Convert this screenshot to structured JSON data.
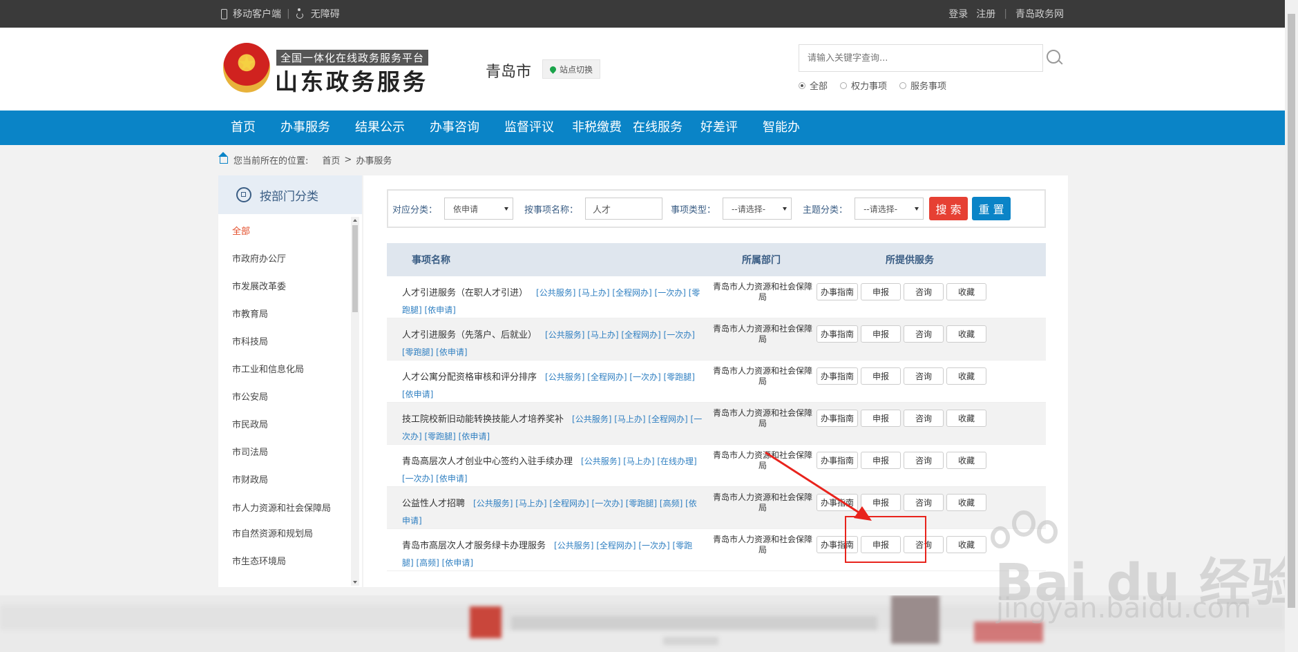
{
  "topbar": {
    "mobile_client": "移动客户端",
    "accessibility": "无障碍",
    "login": "登录",
    "register": "注册",
    "site_link": "青岛政务网"
  },
  "header": {
    "platform_subtitle": "全国一体化在线政务服务平台",
    "brand_title": "山东政务服务",
    "city": "青岛市",
    "switch_site": "站点切换",
    "search_placeholder": "请输入关键字查询...",
    "radio_options": [
      "全部",
      "权力事项",
      "服务事项"
    ],
    "radio_selected": "全部"
  },
  "nav": {
    "items": [
      "首页",
      "办事服务",
      "结果公示",
      "办事咨询",
      "监督评议",
      "非税缴费",
      "在线服务",
      "好差评",
      "智能办"
    ]
  },
  "breadcrumb": {
    "prefix": "您当前所在的位置:",
    "home": "首页",
    "separator": ">",
    "current": "办事服务"
  },
  "sidebar": {
    "title": "按部门分类",
    "items": [
      "全部",
      "市政府办公厅",
      "市发展改革委",
      "市教育局",
      "市科技局",
      "市工业和信息化局",
      "市公安局",
      "市民政局",
      "市司法局",
      "市财政局",
      "市人力资源和社会保障局",
      "市自然资源和规划局",
      "市生态环境局"
    ],
    "active": "全部"
  },
  "filter": {
    "category_label": "对应分类：",
    "category_value": "依申请",
    "name_label": "按事项名称：",
    "name_value": "人才",
    "type_label": "事项类型：",
    "type_value": "--请选择-",
    "theme_label": "主题分类：",
    "theme_value": "--请选择-",
    "search_button": "搜 索",
    "reset_button": "重 置"
  },
  "table": {
    "headers": [
      "事项名称",
      "所属部门",
      "所提供服务"
    ],
    "service_buttons": [
      "办事指南",
      "申报",
      "咨询",
      "收藏"
    ],
    "rows": [
      {
        "name": "人才引进服务（在职人才引进）",
        "tags": "[公共服务] [马上办] [全程网办] [一次办] [零跑腿] [依申请]",
        "dept": "青岛市人力资源和社会保障局"
      },
      {
        "name": "人才引进服务（先落户、后就业）",
        "tags": "[公共服务] [马上办] [全程网办] [一次办] [零跑腿] [依申请]",
        "dept": "青岛市人力资源和社会保障局"
      },
      {
        "name": "人才公寓分配资格审核和评分排序",
        "tags": "[公共服务] [全程网办] [一次办] [零跑腿] [依申请]",
        "dept": "青岛市人力资源和社会保障局"
      },
      {
        "name": "技工院校新旧动能转换技能人才培养奖补",
        "tags": "[公共服务] [马上办] [全程网办] [一次办] [零跑腿] [依申请]",
        "dept": "青岛市人力资源和社会保障局"
      },
      {
        "name": "青岛高层次人才创业中心签约入驻手续办理",
        "tags": "[公共服务] [马上办] [在线办理] [一次办] [依申请]",
        "dept": "青岛市人力资源和社会保障局"
      },
      {
        "name": "公益性人才招聘",
        "tags": "[公共服务] [马上办] [全程网办] [一次办] [零跑腿] [高频] [依申请]",
        "dept": "青岛市人力资源和社会保障局"
      },
      {
        "name": "青岛市高层次人才服务绿卡办理服务",
        "tags": "[公共服务] [全程网办] [一次办] [零跑腿] [高频] [依申请]",
        "dept": "青岛市人力资源和社会保障局"
      }
    ]
  },
  "watermark": {
    "brand": "Bai du 经验",
    "url": "jingyan.baidu.com"
  },
  "colors": {
    "nav_blue": "#0a84c7",
    "search_red": "#e64033",
    "tag_blue": "#2f7fc1",
    "annotation_red": "#e8231c",
    "sidebar_active": "#e34d2a"
  }
}
